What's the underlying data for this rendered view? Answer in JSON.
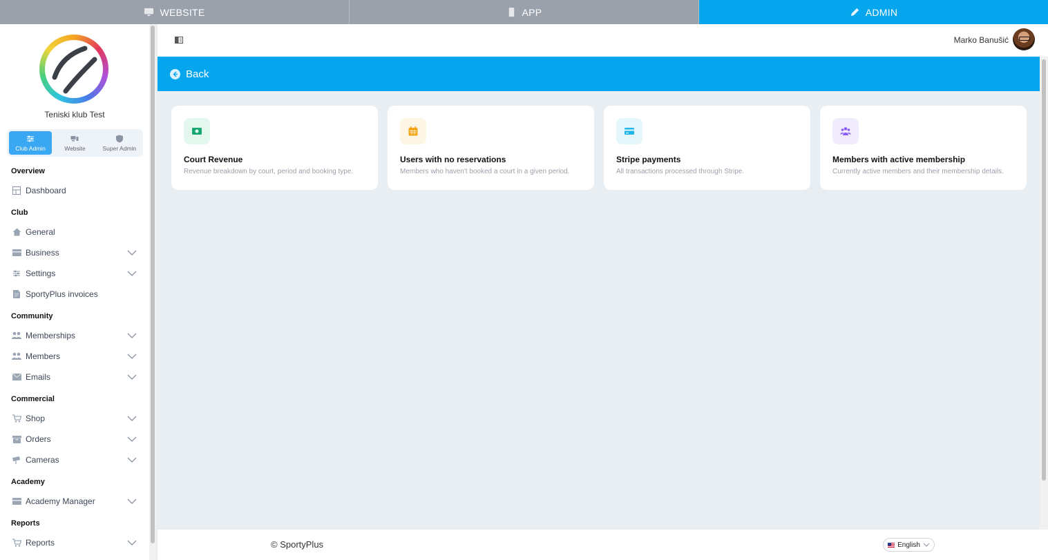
{
  "topbar": {
    "modes": [
      {
        "label": "WEBSITE",
        "icon": "monitor-icon",
        "active": false
      },
      {
        "label": "APP",
        "icon": "mobile-icon",
        "active": false
      },
      {
        "label": "ADMIN",
        "icon": "pencil-icon",
        "active": true
      }
    ]
  },
  "sidebar": {
    "club_name": "Teniski klub Test",
    "roles": [
      {
        "label": "Club Admin",
        "icon": "sliders-icon",
        "active": true
      },
      {
        "label": "Website",
        "icon": "devices-icon",
        "active": false
      },
      {
        "label": "Super Admin",
        "icon": "shield-icon",
        "active": false
      }
    ],
    "sections": {
      "overview": "Overview",
      "club": "Club",
      "community": "Community",
      "commercial": "Commercial",
      "academy": "Academy",
      "reports": "Reports"
    },
    "items": {
      "dashboard": "Dashboard",
      "general": "General",
      "business": "Business",
      "settings": "Settings",
      "sportyplus_invoices": "SportyPlus invoices",
      "memberships": "Memberships",
      "members": "Members",
      "emails": "Emails",
      "shop": "Shop",
      "orders": "Orders",
      "cameras": "Cameras",
      "academy_manager": "Academy Manager",
      "reports": "Reports"
    }
  },
  "header": {
    "user_name": "Marko Banušić"
  },
  "backbar": {
    "label": "Back"
  },
  "cards": [
    {
      "title": "Court Revenue",
      "desc": "Revenue breakdown by court, period and booking type.",
      "icon": "cash-icon",
      "color": "#18a672",
      "bg": "#e4f7ef"
    },
    {
      "title": "Users with no reservations",
      "desc": "Members who haven't booked a court in a given period.",
      "icon": "calendar-icon",
      "color": "#f2a516",
      "bg": "#fdf6e4"
    },
    {
      "title": "Stripe payments",
      "desc": "All transactions processed through Stripe.",
      "icon": "credit-card-icon",
      "color": "#1fb6e8",
      "bg": "#e6f7fc"
    },
    {
      "title": "Members with active membership",
      "desc": "Currently active members and their membership details.",
      "icon": "users-icon",
      "color": "#8b5cf6",
      "bg": "#f1ecfd"
    }
  ],
  "footer": {
    "copyright": "© SportyPlus",
    "language": "English"
  },
  "colors": {
    "accent": "#06a6ee",
    "inactive_mode": "#9aa1ab"
  }
}
